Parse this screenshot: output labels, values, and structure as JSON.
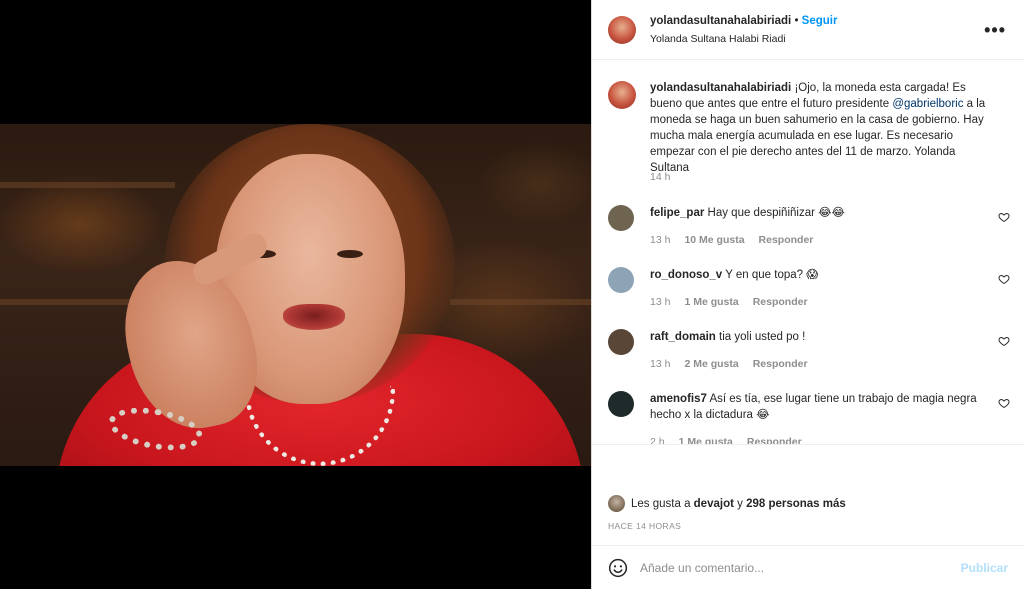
{
  "post": {
    "username": "yolandasultanahalabiriadi",
    "dot": "•",
    "follow_label": "Seguir",
    "fullname": "Yolanda Sultana Halabi Riadi",
    "more_label": "•••"
  },
  "caption": {
    "username": "yolandasultanahalabiriadi",
    "text_before": "¡Ojo, la moneda esta cargada! Es bueno que antes que entre el futuro presidente ",
    "mention": "@gabrielboric",
    "text_after": " a la moneda se haga un buen sahumerio en la casa de gobierno. Hay mucha mala energía acumulada en ese lugar. Es necesario empezar con el pie derecho antes del 11 de marzo. Yolanda Sultana",
    "time": "14 h"
  },
  "comments": [
    {
      "username": "felipe_par",
      "text": "Hay que despiñiñizar 😂😂",
      "time": "13 h",
      "likes": "10 Me gusta",
      "reply": "Responder",
      "avatar_color": "#6f6450"
    },
    {
      "username": "ro_donoso_v",
      "text": "Y en que topa? 😱",
      "time": "13 h",
      "likes": "1 Me gusta",
      "reply": "Responder",
      "avatar_color": "#8ea3b6"
    },
    {
      "username": "raft_domain",
      "text": "tia yoli usted po !",
      "time": "13 h",
      "likes": "2 Me gusta",
      "reply": "Responder",
      "avatar_color": "#5a4636"
    },
    {
      "username": "amenofis7",
      "text": "Así es tía, ese lugar tiene un trabajo de magia negra hecho x la dictadura 😂",
      "time": "2 h",
      "likes": "1 Me gusta",
      "reply": "Responder",
      "avatar_color": "#1f2a2a"
    }
  ],
  "likes": {
    "prefix": "Les gusta a ",
    "first": "devajot",
    "middle": " y ",
    "rest": "298 personas más",
    "time_ago": "HACE 14 HORAS"
  },
  "composer": {
    "placeholder": "Añade un comentario...",
    "publish_label": "Publicar"
  }
}
